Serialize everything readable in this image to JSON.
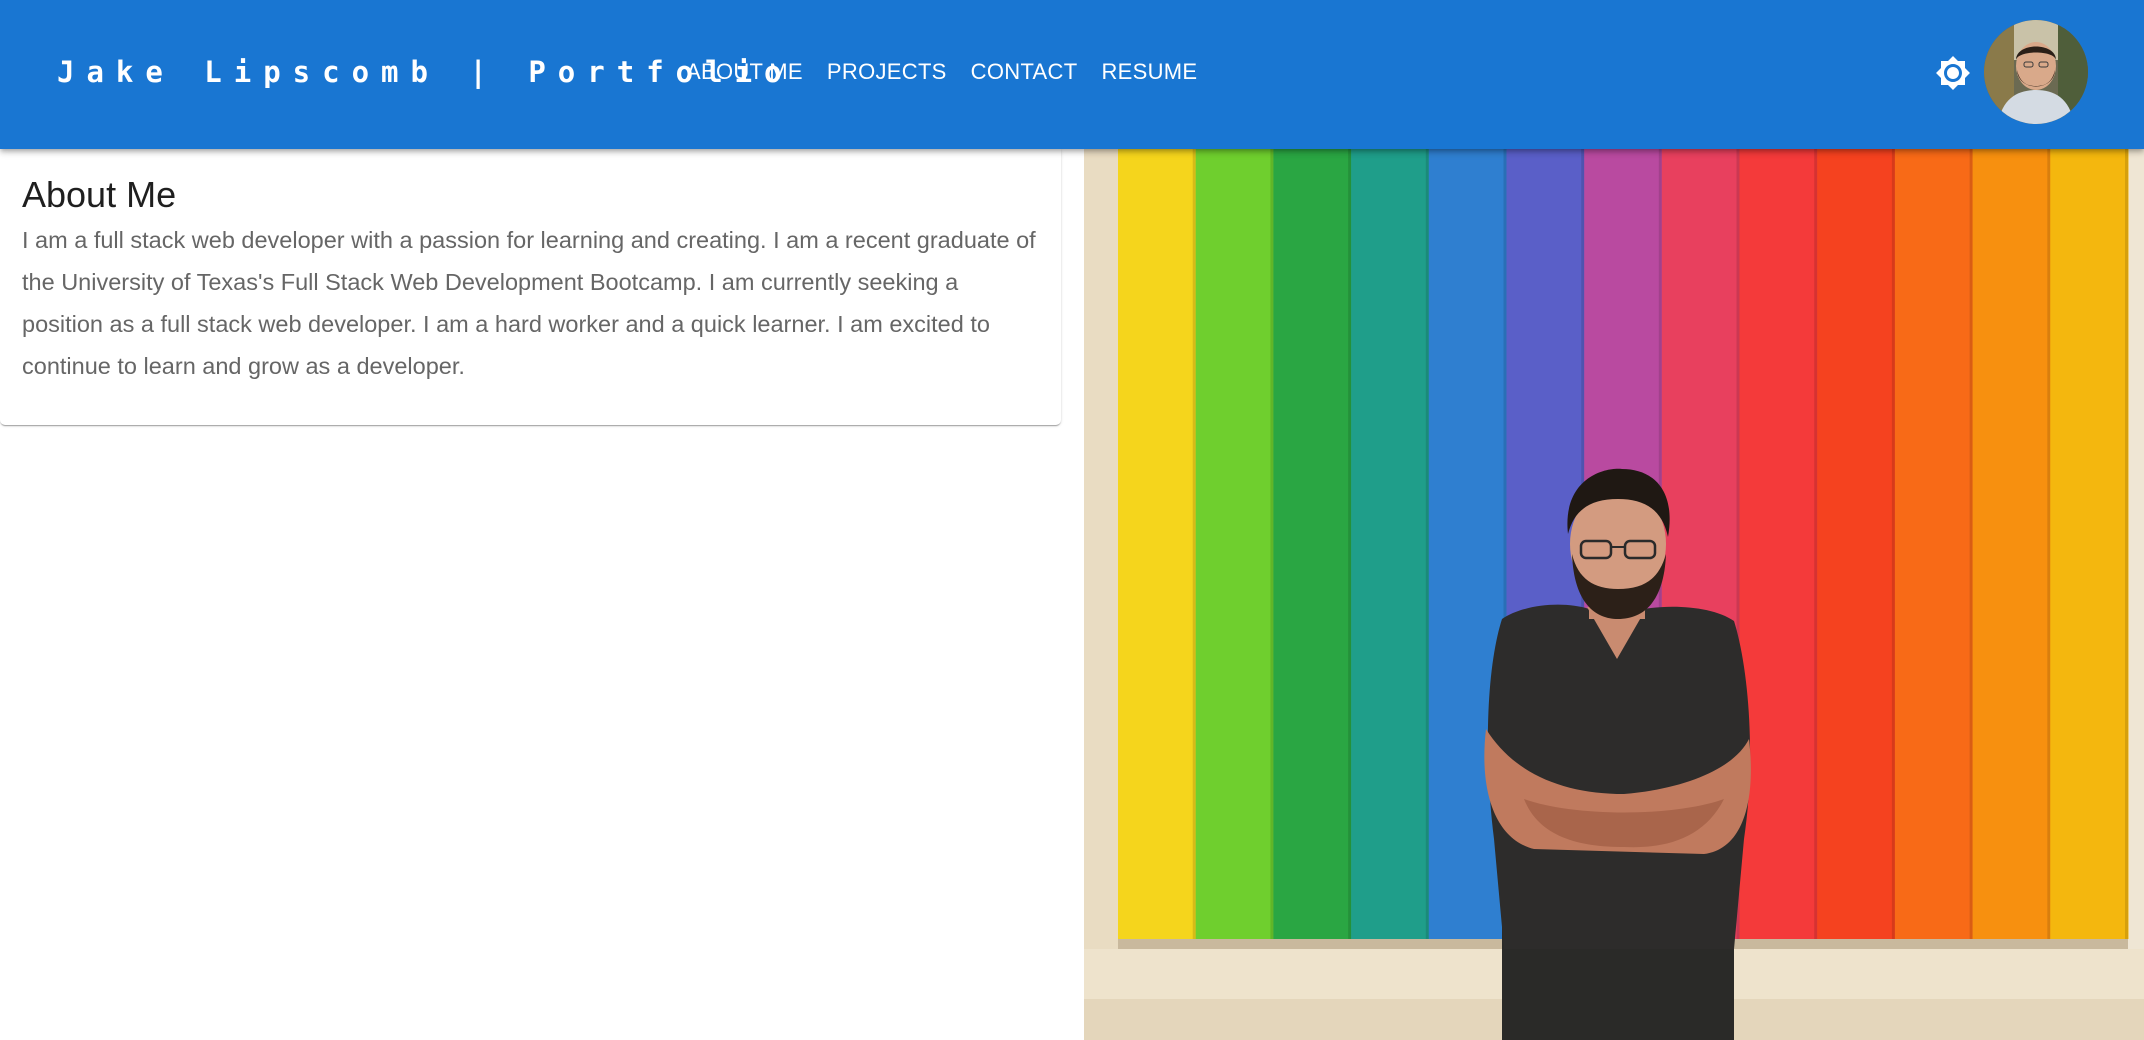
{
  "header": {
    "brand": "Jake Lipscomb | Portfolio",
    "nav": [
      {
        "label": "ABOUT ME"
      },
      {
        "label": "PROJECTS"
      },
      {
        "label": "CONTACT"
      },
      {
        "label": "RESUME"
      }
    ],
    "theme_icon": "brightness-icon",
    "avatar_icon": "avatar-photo",
    "bar_color": "#1976d2"
  },
  "about": {
    "title": "About Me",
    "body": "I am a full stack web developer with a passion for learning and creating. I am a recent graduate of the University of Texas's Full Stack Web Development Bootcamp. I am currently seeking a position as a full stack web developer. I am a hard worker and a quick learner. I am excited to continue to learn and grow as a developer."
  },
  "hero": {
    "stripe_colors": [
      "#f5d51c",
      "#6fcf2e",
      "#2aa643",
      "#1f9e8a",
      "#2f7fd0",
      "#5a5fc8",
      "#b94aa0",
      "#e8405e",
      "#f43a3a",
      "#f5421f",
      "#f86a17",
      "#f7900f",
      "#f4b70e"
    ]
  }
}
